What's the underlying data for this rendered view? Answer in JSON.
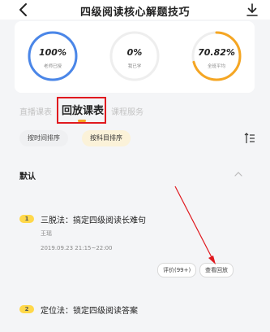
{
  "header": {
    "title": "四级阅读核心解题技巧",
    "back_icon": "chevron-left-icon",
    "download_icon": "download-icon"
  },
  "stats": [
    {
      "value": "100%",
      "label": "老师已授",
      "progress": 1.0,
      "color": "#4a86e8"
    },
    {
      "value": "0%",
      "label": "我已学",
      "progress": 0.0,
      "color": "#eeeeee"
    },
    {
      "value": "70.82%",
      "label": "全班平均",
      "progress": 0.7082,
      "color": "#f5a623"
    }
  ],
  "tabs": [
    {
      "label": "直播课表",
      "active": false
    },
    {
      "label": "回放课表",
      "active": true
    },
    {
      "label": "课程服务",
      "active": false
    }
  ],
  "sort": {
    "options": [
      {
        "label": "按时间排序",
        "active": false
      },
      {
        "label": "按科目排序",
        "active": true
      }
    ],
    "sort_icon": "sort-list-icon"
  },
  "section": {
    "title": "默认",
    "collapse_icon": "chevron-up-icon"
  },
  "lessons": [
    {
      "number": "1",
      "title": "三脱法：搞定四级阅读长难句",
      "teacher": "王瑶",
      "time": "2019.09.23 21:15~22:00",
      "rate_label": "评价(99+)",
      "replay_label": "查看回放"
    },
    {
      "number": "2",
      "title": "定位法：锁定四级阅读答案"
    }
  ],
  "colors": {
    "accent": "#f5a623",
    "blue": "#4a86e8",
    "annotation_red": "#e0191f"
  }
}
